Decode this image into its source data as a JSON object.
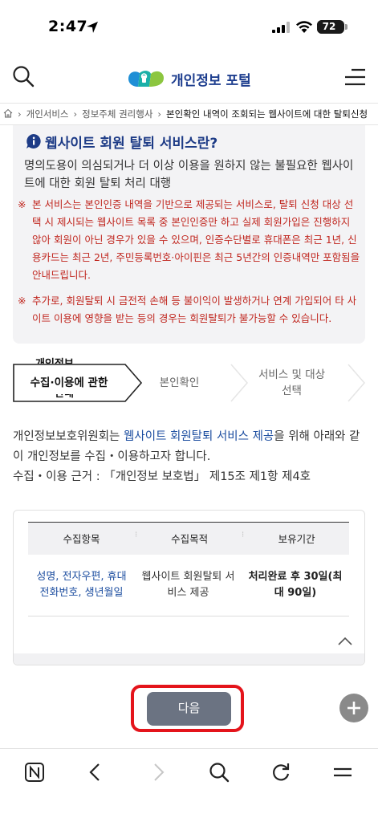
{
  "status_bar": {
    "time": "2:47",
    "battery": "72"
  },
  "header": {
    "logo_text": "개인정보 포털"
  },
  "breadcrumb": [
    "개인서비스",
    "정보주체 권리행사",
    "본인확인 내역이 조회되는 웹사이트에 대한 탈퇴신청"
  ],
  "info": {
    "title": "웹사이트 회원 탈퇴 서비스란?",
    "description": "명의도용이 의심되거나 더 이상 이용을 원하지 않는 불필요한 웹사이트에 대한 회원 탈퇴 처리 대행",
    "note_mark": "※",
    "note1": "본 서비스는 본인인증 내역을 기반으로 제공되는 서비스로, 탈퇴 신청 대상 선택 시 제시되는 웹사이트 목록 중 본인인증만 하고 실제 회원가입은 진행하지 않아 회원이 아닌 경우가 있을 수 있으며, 인증수단별로 휴대폰은 최근 1년, 신용카드는 최근 2년, 주민등록번호·아이핀은 최근 5년간의 인증내역만 포함됨을 안내드립니다.",
    "note2": "추가로, 회원탈퇴 시 금전적 손해 등 불이익이 발생하거나 연계 가입되어 타 사이트 이용에 영향을 받는 등의 경우는 회원탈퇴가 불가능할 수 있습니다."
  },
  "steps": [
    {
      "label": "수집·이용에 관한",
      "top_fragment": "개인정보",
      "bottom_fragment": "안내"
    },
    {
      "label": "본인확인"
    },
    {
      "label": "서비스 및 대상 선택"
    }
  ],
  "intro": {
    "part1": "개인정보보호위원회는 ",
    "link": "웹사이트 회원탈퇴 서비스 제공",
    "part2": "을 위해 아래와 같이 개인정보를 수집・이용하고자 합니다.",
    "basis": "수집・이용 근거 : 「개인정보 보호법」 제15조 제1항 제4호"
  },
  "table": {
    "headers": [
      "수집항목",
      "수집목적",
      "보유기간"
    ],
    "separator": "⁝",
    "row": {
      "items": "성명, 전자우편, 휴대전화번호, 생년월일",
      "purpose": "웹사이트 회원탈퇴 서비스 제공",
      "retention": "처리완료 후 30일(최대 90일)"
    }
  },
  "next_button": {
    "label": "다음"
  },
  "colors": {
    "brand_blue": "#1d3b86",
    "note_red": "#c0261e",
    "highlight_red": "#e4141b",
    "button_gray": "#6b7382"
  },
  "icons": {
    "status": [
      "location-arrow-icon",
      "signal-icon",
      "wifi-icon",
      "battery-icon"
    ],
    "header": [
      "search-icon",
      "logo-icon",
      "menu-icon"
    ],
    "browser_bar": [
      "naver-icon",
      "back-icon",
      "forward-icon",
      "search-icon",
      "refresh-icon",
      "menu-icon"
    ]
  }
}
